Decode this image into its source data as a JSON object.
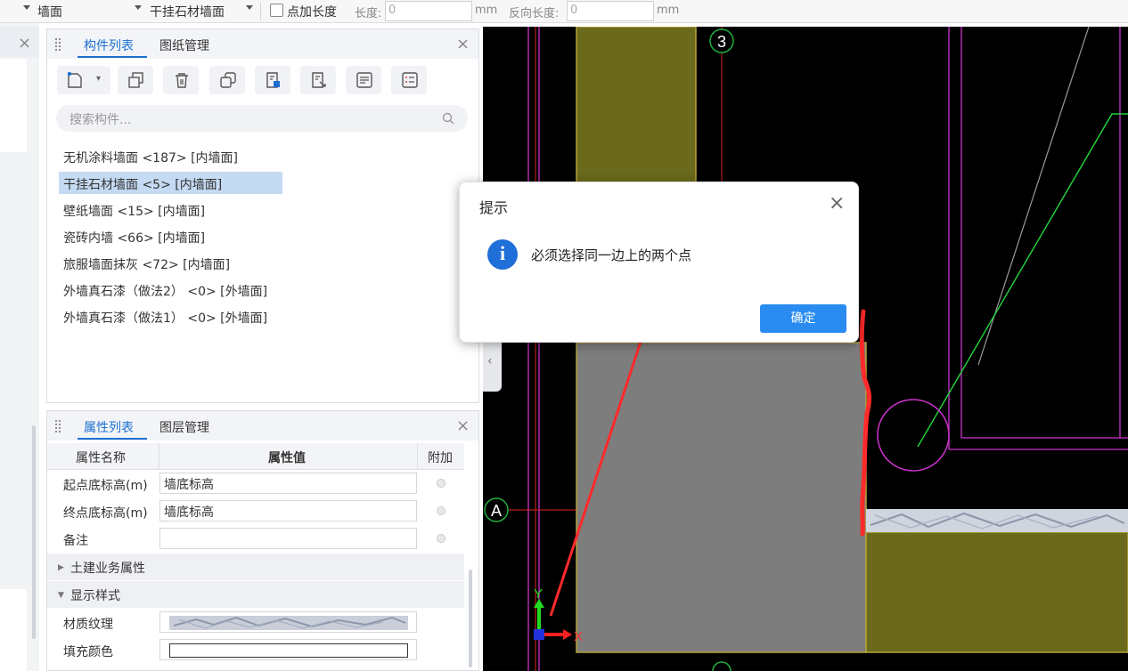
{
  "toolbar": {
    "type_value": "墙面",
    "component_value": "干挂石材墙面",
    "add_length_label": "点加长度",
    "length_label": "长度:",
    "length_value": "0",
    "length_unit": "mm",
    "reverse_length_label": "反向长度:",
    "reverse_length_value": "0",
    "reverse_unit": "mm"
  },
  "component_panel": {
    "tabs": [
      {
        "label": "构件列表",
        "active": true
      },
      {
        "label": "图纸管理",
        "active": false
      }
    ],
    "toolbar_icons": [
      "new-component-icon",
      "dropdown-arrow-icon",
      "copy-icon",
      "delete-icon",
      "duplicate-layer-icon",
      "import-icon",
      "export-icon",
      "list-view-icon",
      "properties-icon"
    ],
    "search_placeholder": "搜索构件...",
    "items": [
      {
        "label": "无机涂料墙面 <187> [内墙面]",
        "selected": false
      },
      {
        "label": "干挂石材墙面 <5> [内墙面]",
        "selected": true
      },
      {
        "label": "壁纸墙面 <15> [内墙面]",
        "selected": false
      },
      {
        "label": "瓷砖内墙 <66> [内墙面]",
        "selected": false
      },
      {
        "label": "旅服墙面抹灰 <72> [内墙面]",
        "selected": false
      },
      {
        "label": "外墙真石漆（做法2） <0> [外墙面]",
        "selected": false
      },
      {
        "label": "外墙真石漆（做法1） <0> [外墙面]",
        "selected": false
      }
    ]
  },
  "property_panel": {
    "tabs": [
      {
        "label": "属性列表",
        "active": true
      },
      {
        "label": "图层管理",
        "active": false
      }
    ],
    "headers": {
      "name": "属性名称",
      "value": "属性值",
      "extra": "附加"
    },
    "rows": [
      {
        "name": "起点底标高(m)",
        "value": "墙底标高"
      },
      {
        "name": "终点底标高(m)",
        "value": "墙底标高"
      },
      {
        "name": "备注",
        "value": ""
      }
    ],
    "groups": [
      {
        "label": "土建业务属性",
        "expanded": false
      },
      {
        "label": "显示样式",
        "expanded": true
      }
    ],
    "style_rows": [
      {
        "name": "材质纹理"
      },
      {
        "name": "填充颜色"
      }
    ]
  },
  "canvas": {
    "axis_labels": [
      "3",
      "A"
    ],
    "ucs_x": "X",
    "ucs_y": "Y"
  },
  "dialog": {
    "title": "提示",
    "message": "必须选择同一边上的两个点",
    "ok_label": "确定"
  },
  "colors": {
    "accent": "#1c6fd1",
    "canvas_bg": "#000000",
    "wall_olive": "#6b6a1c",
    "annotation_red": "#ff2a2a",
    "magenta_line": "#cc33cc",
    "ok_button": "#2a8cf0"
  }
}
